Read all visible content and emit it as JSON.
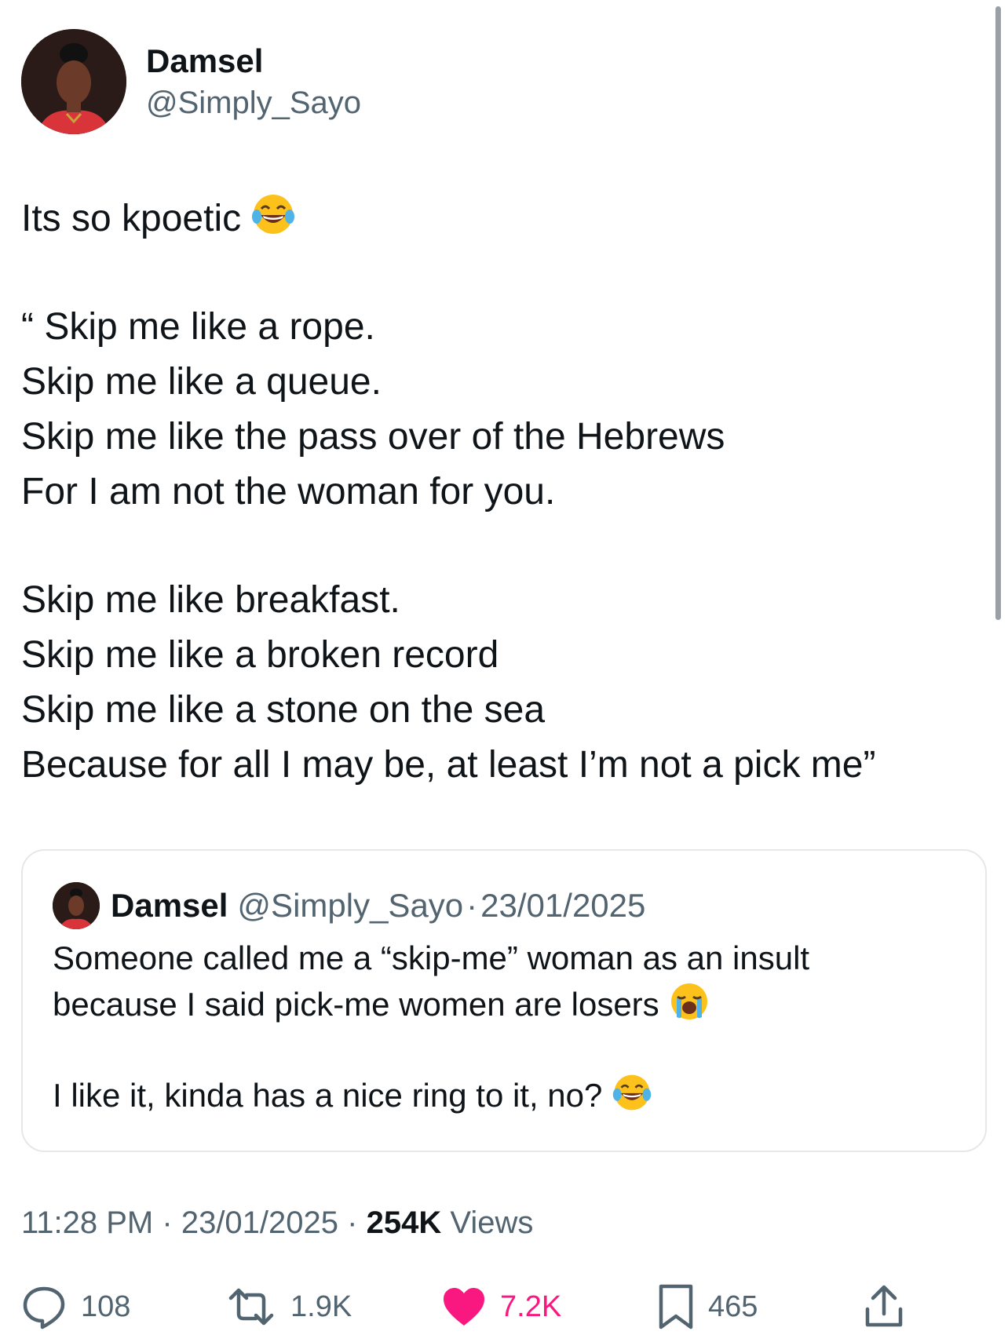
{
  "author": {
    "display_name": "Damsel",
    "handle": "@Simply_Sayo"
  },
  "tweet": {
    "lines": [
      "Its so kpoetic",
      "“ Skip me like a rope.",
      "Skip me like a queue.",
      "Skip me like the pass over of the Hebrews",
      "For I am not the woman for you.",
      "Skip me like breakfast.",
      "Skip me like a broken record",
      "Skip me like a stone on the sea",
      "Because for all I may be, at least I’m not a pick me”"
    ],
    "emoji": "face-with-tears-of-joy"
  },
  "quoted": {
    "display_name": "Damsel",
    "handle": "@Simply_Sayo",
    "separator": "·",
    "date": "23/01/2025",
    "lines": [
      "Someone called me a “skip-me” woman as an insult",
      "because I said pick-me women are losers",
      "I like it, kinda has a nice ring to it, no?"
    ],
    "emojis": [
      "loudly-crying-face",
      "face-with-tears-of-joy"
    ]
  },
  "meta": {
    "time": "11:28 PM",
    "separator": "·",
    "date": "23/01/2025",
    "views_count": "254K",
    "views_label": "Views"
  },
  "actions": {
    "replies": "108",
    "reposts": "1.9K",
    "likes": "7.2K",
    "bookmarks": "465"
  },
  "colors": {
    "like": "#f91880",
    "secondary_text": "#536471",
    "primary_text": "#0f1419"
  }
}
